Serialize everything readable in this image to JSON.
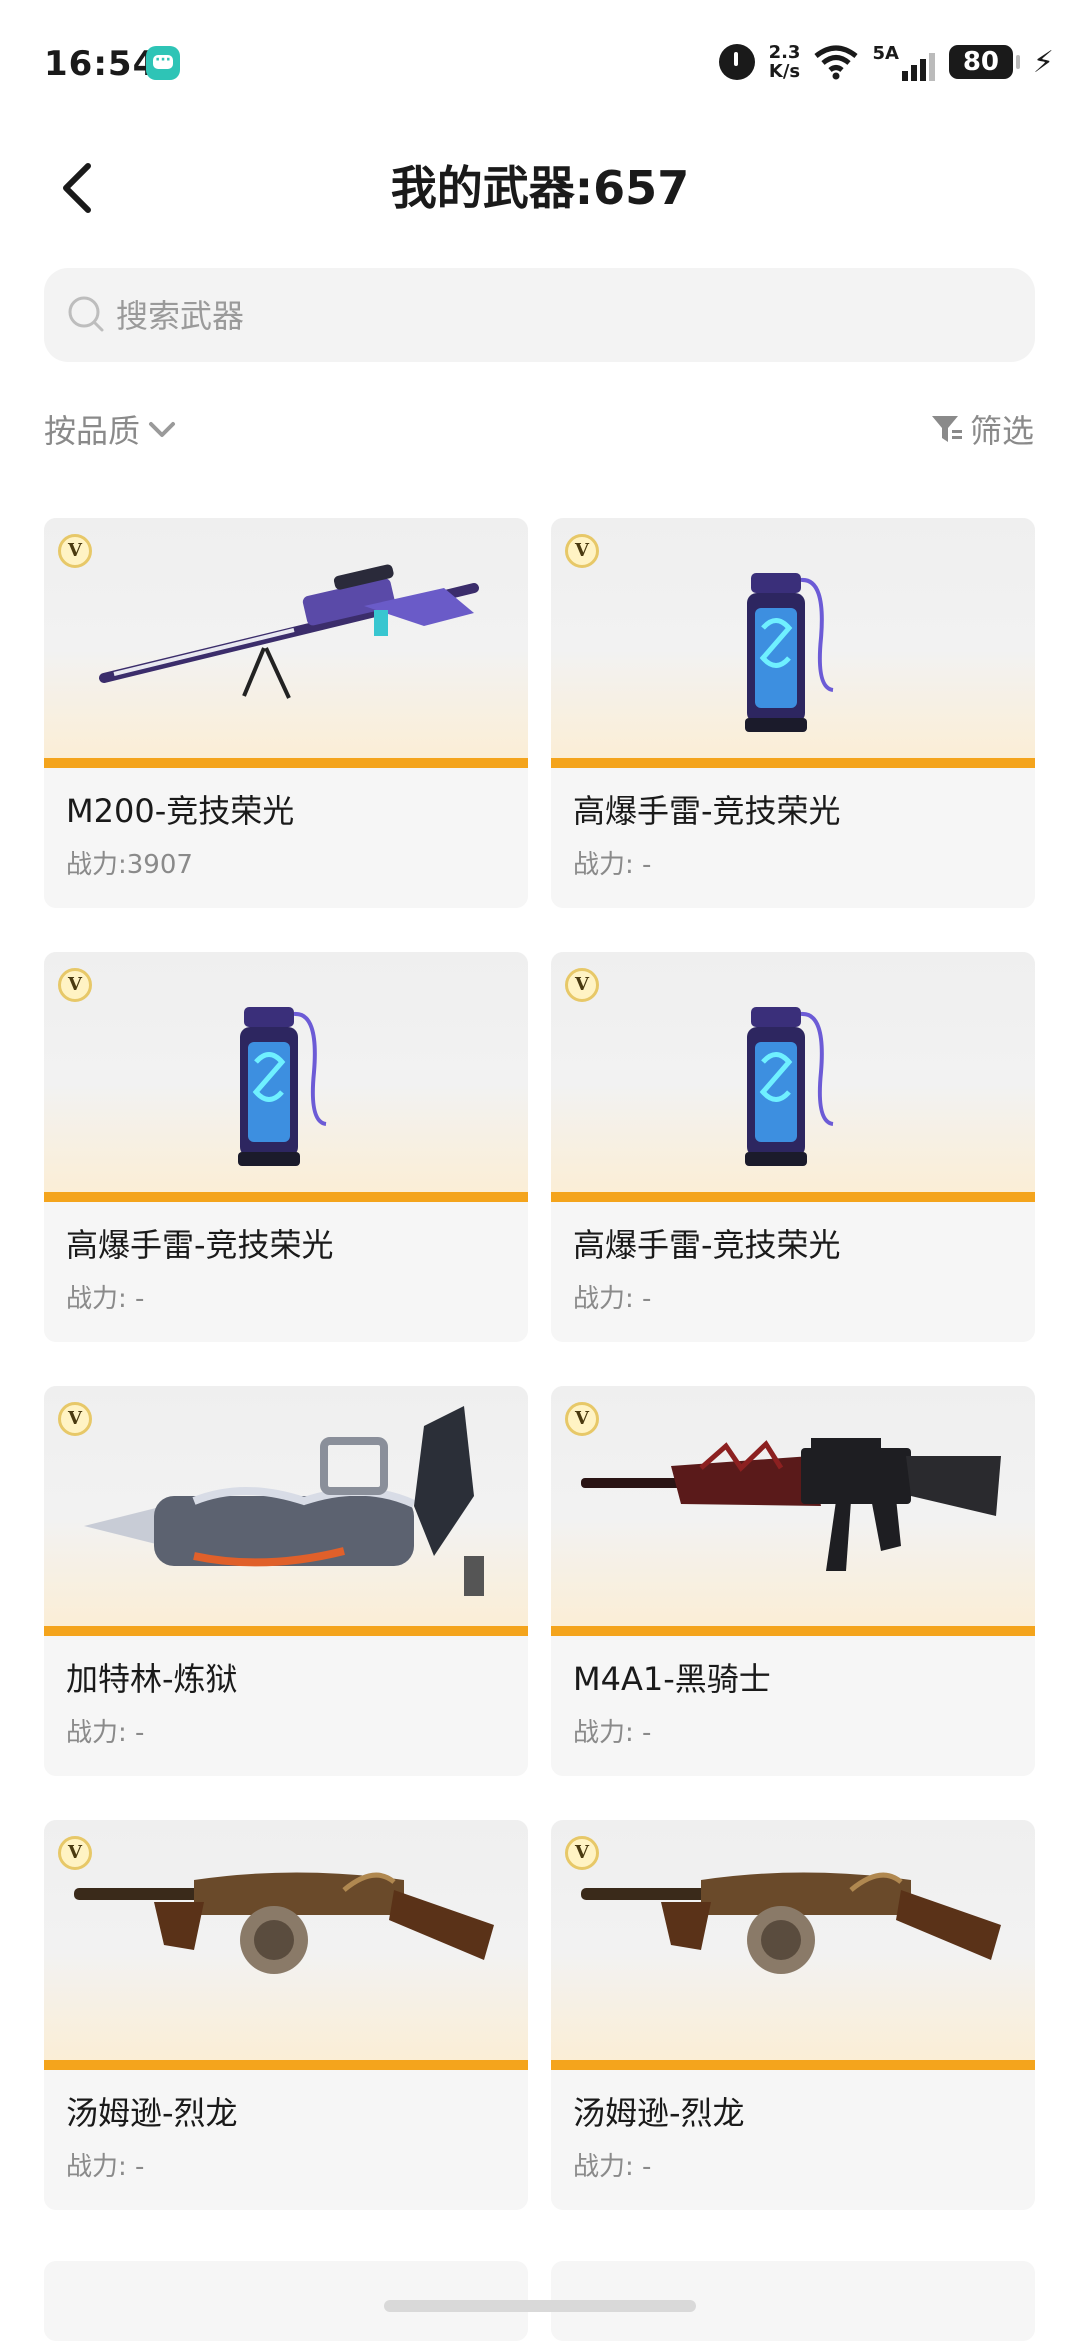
{
  "status_bar": {
    "time": "16:54",
    "net_speed_value": "2.3",
    "net_speed_unit": "K/s",
    "network_type": "5A",
    "battery": "80"
  },
  "header": {
    "title": "我的武器:657"
  },
  "search": {
    "placeholder": "搜索武器"
  },
  "filters": {
    "sort_label": "按品质",
    "filter_label": "筛选"
  },
  "weapons": [
    {
      "name": "M200-竞技荣光",
      "power": "战力:3907",
      "badge": "V",
      "icon": "sniper-rifle-icon"
    },
    {
      "name": "高爆手雷-竞技荣光",
      "power": "战力: -",
      "badge": "V",
      "icon": "grenade-icon"
    },
    {
      "name": "高爆手雷-竞技荣光",
      "power": "战力: -",
      "badge": "V",
      "icon": "grenade-icon"
    },
    {
      "name": "高爆手雷-竞技荣光",
      "power": "战力: -",
      "badge": "V",
      "icon": "grenade-icon"
    },
    {
      "name": "加特林-炼狱",
      "power": "战力: -",
      "badge": "V",
      "icon": "gatling-gun-icon"
    },
    {
      "name": "M4A1-黑骑士",
      "power": "战力: -",
      "badge": "V",
      "icon": "assault-rifle-icon"
    },
    {
      "name": "汤姆逊-烈龙",
      "power": "战力: -",
      "badge": "V",
      "icon": "tommy-gun-icon"
    },
    {
      "name": "汤姆逊-烈龙",
      "power": "战力: -",
      "badge": "V",
      "icon": "tommy-gun-icon"
    }
  ],
  "colors": {
    "accent_bar": "#f4a41c",
    "card_bg": "#f6f6f6",
    "search_bg": "#f3f3f3"
  }
}
